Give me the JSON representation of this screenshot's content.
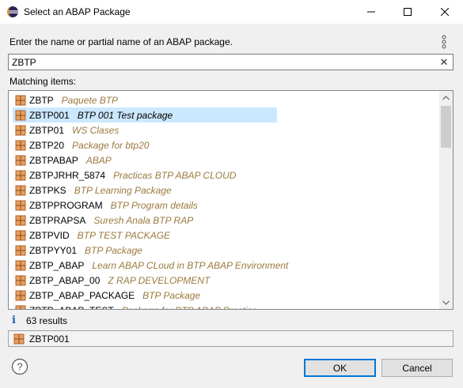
{
  "window": {
    "title": "Select an ABAP Package",
    "minimize_icon": "minimize-icon",
    "maximize_icon": "maximize-icon",
    "close_icon": "close-icon"
  },
  "instruction": "Enter the name or partial name of an ABAP package.",
  "search": {
    "value": "ZBTP",
    "placeholder": ""
  },
  "matching_label": "Matching items:",
  "items": [
    {
      "name": "ZBTP",
      "desc": "Paquete BTP"
    },
    {
      "name": "ZBTP001",
      "desc": "BTP 001 Test package",
      "selected": true
    },
    {
      "name": "ZBTP01",
      "desc": "WS Clases"
    },
    {
      "name": "ZBTP20",
      "desc": "Package for btp20"
    },
    {
      "name": "ZBTPABAP",
      "desc": "ABAP"
    },
    {
      "name": "ZBTPJRHR_5874",
      "desc": "Practicas BTP ABAP CLOUD"
    },
    {
      "name": "ZBTPKS",
      "desc": "BTP Learning Package"
    },
    {
      "name": "ZBTPPROGRAM",
      "desc": "BTP Program details"
    },
    {
      "name": "ZBTPRAPSA",
      "desc": "Suresh Anala BTP RAP"
    },
    {
      "name": "ZBTPVID",
      "desc": "BTP TEST PACKAGE"
    },
    {
      "name": "ZBTPYY01",
      "desc": "BTP Package"
    },
    {
      "name": "ZBTP_ABAP",
      "desc": "Learn ABAP CLoud in BTP ABAP Environment"
    },
    {
      "name": "ZBTP_ABAP_00",
      "desc": "Z RAP DEVELOPMENT"
    },
    {
      "name": "ZBTP_ABAP_PACKAGE",
      "desc": "BTP Package"
    },
    {
      "name": "ZBTP_ABAP_TEST",
      "desc": "Package for BTP ABAP Practice"
    }
  ],
  "results": "63 results",
  "selected_detail": "ZBTP001",
  "buttons": {
    "ok": "OK",
    "cancel": "Cancel"
  },
  "colors": {
    "selection": "#cce8ff",
    "description": "#9b7a3e",
    "package_icon": "#c8743a",
    "info": "#1b5fb4",
    "ok_border": "#0078d7"
  }
}
